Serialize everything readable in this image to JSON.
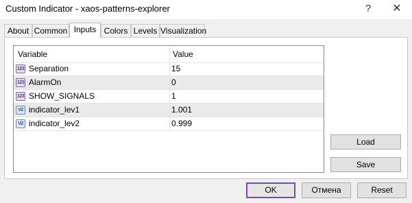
{
  "window": {
    "title": "Custom Indicator - xaos-patterns-explorer",
    "help_glyph": "?",
    "close_glyph": "✕"
  },
  "tabs": [
    {
      "label": "About"
    },
    {
      "label": "Common"
    },
    {
      "label": "Inputs",
      "active": true
    },
    {
      "label": "Colors"
    },
    {
      "label": "Levels"
    },
    {
      "label": "Visualization"
    }
  ],
  "grid": {
    "columns": {
      "variable": "Variable",
      "value": "Value"
    },
    "rows": [
      {
        "type": "int",
        "icon_text": "123",
        "variable": "Separation",
        "value": "15"
      },
      {
        "type": "int",
        "icon_text": "123",
        "variable": "AlarmOn",
        "value": "0"
      },
      {
        "type": "int",
        "icon_text": "123",
        "variable": "SHOW_SIGNALS",
        "value": "1"
      },
      {
        "type": "double",
        "icon_text": "V2",
        "variable": "indicator_lev1",
        "value": "1.001"
      },
      {
        "type": "double",
        "icon_text": "V2",
        "variable": "indicator_lev2",
        "value": "0.999"
      }
    ]
  },
  "side_buttons": {
    "load": "Load",
    "save": "Save"
  },
  "footer_buttons": {
    "ok": "OK",
    "cancel": "Отмена",
    "reset": "Reset"
  },
  "colors": {
    "accent": "#7a49b3",
    "window_bg": "#f0f0f0",
    "panel_bg": "#ffffff"
  }
}
